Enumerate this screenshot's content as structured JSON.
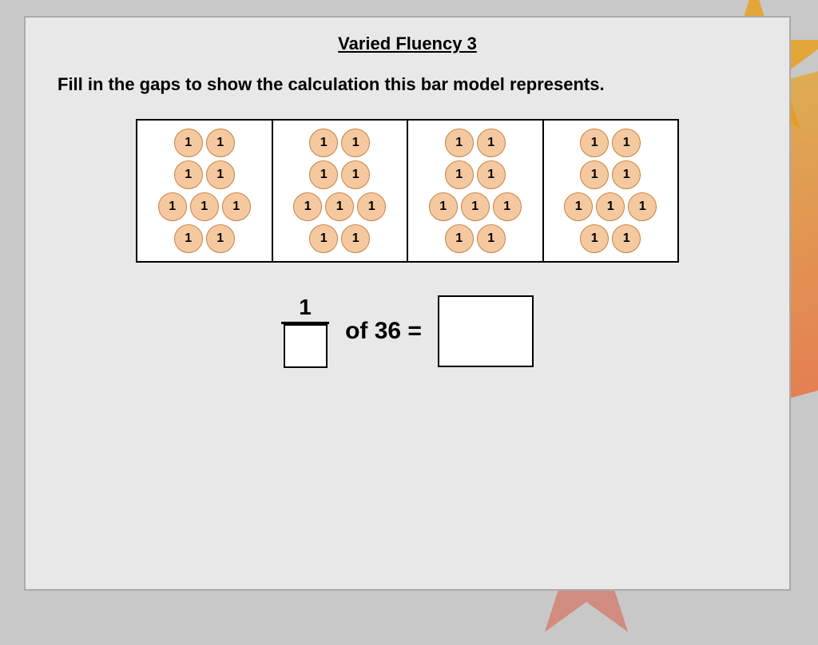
{
  "page": {
    "title": "Varied Fluency 3",
    "instruction": "Fill in the gaps to show the calculation this bar model represents.",
    "bar_model": {
      "sections": [
        {
          "rows": [
            [
              1,
              1
            ],
            [
              1,
              1
            ],
            [
              1,
              1,
              1
            ],
            [
              1,
              1
            ]
          ]
        },
        {
          "rows": [
            [
              1,
              1
            ],
            [
              1,
              1
            ],
            [
              1,
              1,
              1
            ],
            [
              1,
              1
            ]
          ]
        },
        {
          "rows": [
            [
              1,
              1
            ],
            [
              1,
              1
            ],
            [
              1,
              1,
              1
            ],
            [
              1,
              1
            ]
          ]
        },
        {
          "rows": [
            [
              1,
              1
            ],
            [
              1,
              1
            ],
            [
              1,
              1,
              1
            ],
            [
              1,
              1
            ]
          ]
        }
      ]
    },
    "fraction": {
      "numerator": "1",
      "denominator_placeholder": ""
    },
    "of_text": "of 36 =",
    "answer_placeholder": ""
  }
}
